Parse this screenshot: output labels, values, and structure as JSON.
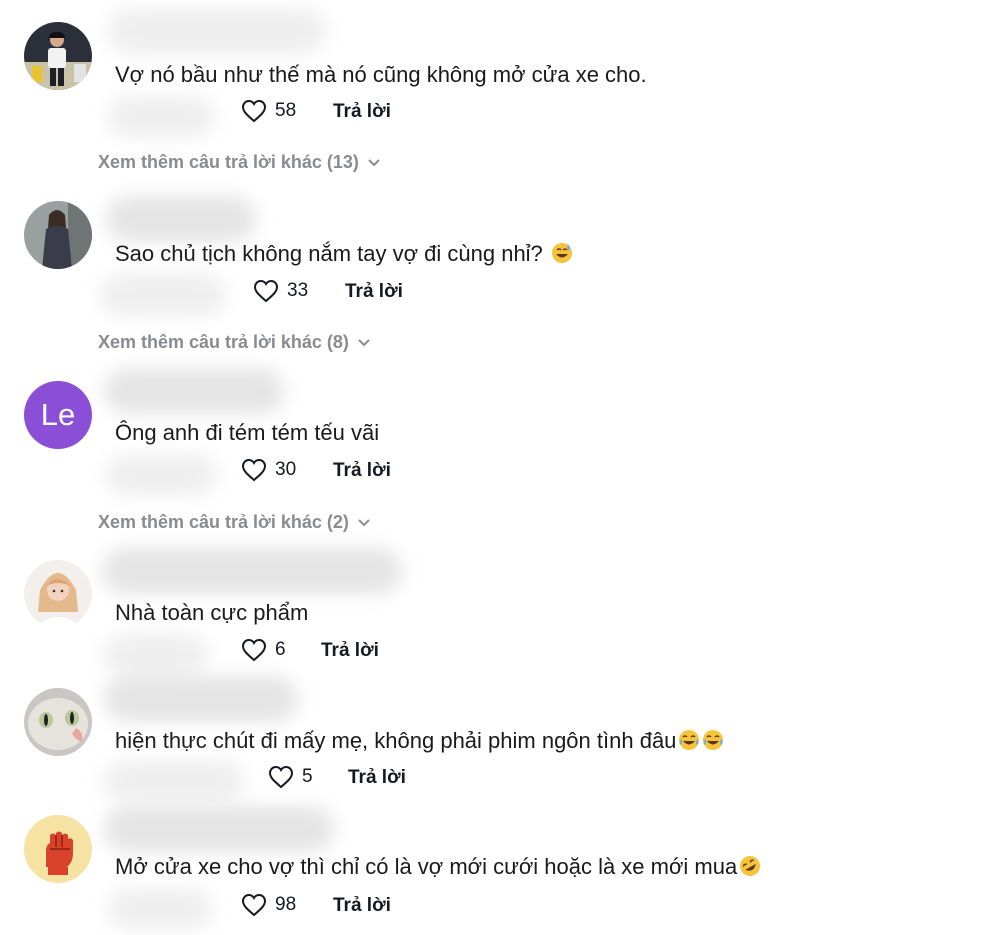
{
  "comments": [
    {
      "avatar": "photo-person-standing",
      "text": "Vợ nó bầu như thế mà nó cũng không mở cửa xe cho.",
      "likes": "58",
      "reply": "Trả lời",
      "more": "Xem thêm câu trả lời khác (13)"
    },
    {
      "avatar": "photo-woman-dark-dress",
      "text": "Sao chủ tịch không nắm tay vợ đi cùng nhỉ?",
      "emoji": "grinning-sweat-emoji",
      "likes": "33",
      "reply": "Trả lời",
      "more": "Xem thêm câu trả lời khác (8)"
    },
    {
      "avatar_letters": "Le",
      "avatar_color": "#8a4fd6",
      "text": "Ông anh đi tém tém tếu vãi",
      "likes": "30",
      "reply": "Trả lời",
      "more": "Xem thêm câu trả lời khác (2)"
    },
    {
      "avatar": "photo-girl-blonde",
      "text": "Nhà toàn cực phẩm",
      "likes": "6",
      "reply": "Trả lời"
    },
    {
      "avatar": "photo-cat",
      "text": "hiện thực chút đi mấy mẹ, không phải phim ngôn tình đâu",
      "emoji": "tears-of-joy-emoji",
      "likes": "5",
      "reply": "Trả lời"
    },
    {
      "avatar": "raised-fist-illustration",
      "text": "Mở cửa xe cho vợ thì chỉ có là vợ mới cưới hoặc là xe mới mua",
      "emoji": "rofl-emoji",
      "likes": "98",
      "reply": "Trả lời"
    }
  ],
  "icons": {
    "like": "heart-outline-icon",
    "expand": "chevron-down-icon"
  },
  "colors": {
    "text": "#161823",
    "muted": "#8a8b91",
    "avatar_le": "#8a4fd6"
  }
}
